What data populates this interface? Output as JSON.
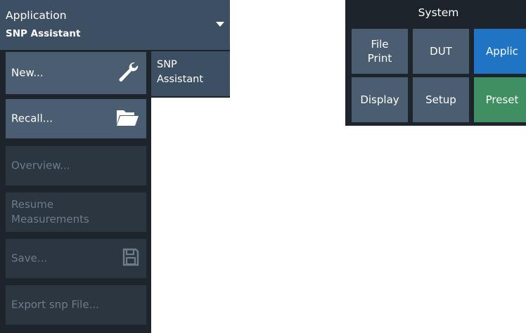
{
  "application": {
    "header": {
      "title": "Application",
      "subtitle": "SNP Assistant"
    },
    "menu": [
      {
        "label": "New...",
        "icon": "wrench-icon",
        "enabled": true
      },
      {
        "label": "Recall...",
        "icon": "folder-open-icon",
        "enabled": true
      },
      {
        "label": "Overview...",
        "enabled": false
      },
      {
        "label": "Resume Measurements",
        "enabled": false
      },
      {
        "label": "Save...",
        "icon": "save-icon",
        "enabled": false
      },
      {
        "label": "Export snp File...",
        "enabled": false
      }
    ],
    "tab": {
      "label": "SNP Assistant"
    }
  },
  "system": {
    "title": "System",
    "buttons": [
      {
        "label": "File Print"
      },
      {
        "label": "DUT"
      },
      {
        "label": "Applic",
        "color": "#1f74c4"
      },
      {
        "label": "Display"
      },
      {
        "label": "Setup"
      },
      {
        "label": "Preset",
        "color": "#3f8f63"
      }
    ]
  },
  "colors": {
    "panel_bg": "#1d242b",
    "button_bg": "#4a5d71",
    "header_bg": "#3d4f62",
    "disabled_bg": "#2b3640",
    "accent_blue": "#1f74c4",
    "accent_green": "#3f8f63"
  }
}
